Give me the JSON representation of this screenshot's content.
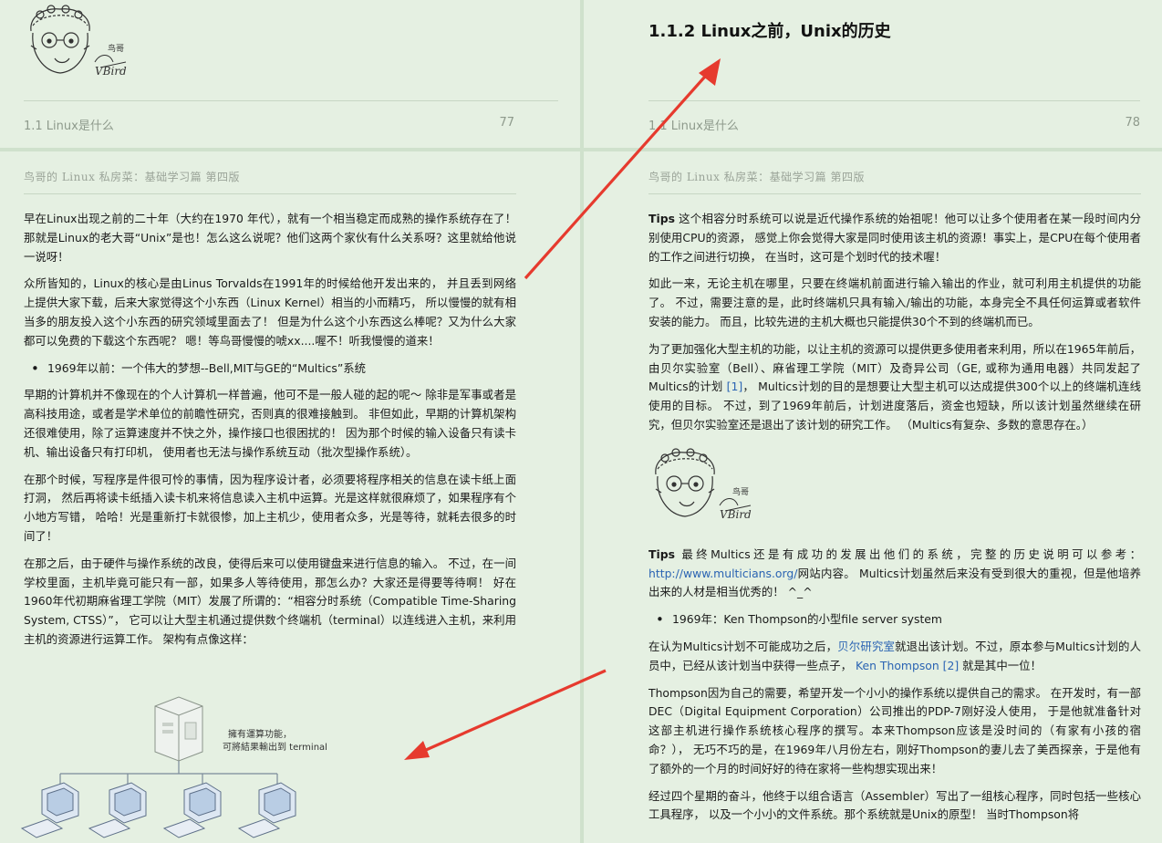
{
  "top": {
    "left": {
      "section": "1.1 Linux是什么",
      "page": "77",
      "logo_text": "鸟哥"
    },
    "right": {
      "heading": "1.1.2 Linux之前，Unix的历史",
      "section": "1.1 Linux是什么",
      "page": "78"
    }
  },
  "left_page": {
    "running_header": "鸟哥的 Linux 私房菜：基础学习篇 第四版",
    "p1": "早在Linux出现之前的二十年（大约在1970 年代），就有一个相当稳定而成熟的操作系统存在了！ 那就是Linux的老大哥“Unix”是也！怎么这么说呢？他们这两个家伙有什么关系呀？这里就给他说一说呀！",
    "p2": "众所皆知的，Linux的核心是由Linus Torvalds在1991年的时候给他开发出来的， 并且丢到网络上提供大家下载，后来大家觉得这个小东西（Linux Kernel）相当的小而精巧， 所以慢慢的就有相当多的朋友投入这个小东西的研究领域里面去了！ 但是为什么这个小东西这么棒呢？又为什么大家都可以免费的下载这个东西呢？ 嗯！等鸟哥慢慢的唬xx....喔不！听我慢慢的道来！",
    "bullet1": "1969年以前：一个伟大的梦想--Bell,MIT与GE的“Multics”系统",
    "p3": "早期的计算机并不像现在的个人计算机一样普遍，他可不是一般人碰的起的呢～ 除非是军事或者是高科技用途，或者是学术单位的前瞻性研究，否则真的很难接触到。 非但如此，早期的计算机架构还很难使用，除了运算速度并不快之外，操作接口也很困扰的！ 因为那个时候的输入设备只有读卡机、输出设备只有打印机， 使用者也无法与操作系统互动（批次型操作系统）。",
    "p4": "在那个时候，写程序是件很可怜的事情，因为程序设计者，必须要将程序相关的信息在读卡纸上面打洞， 然后再将读卡纸插入读卡机来将信息读入主机中运算。光是这样就很麻烦了，如果程序有个小地方写错， 哈哈！光是重新打卡就很惨，加上主机少，使用者众多，光是等待，就耗去很多的时间了！",
    "p5": "在那之后，由于硬件与操作系统的改良，使得后来可以使用键盘来进行信息的输入。 不过，在一间学校里面，主机毕竟可能只有一部，如果多人等待使用，那怎么办？大家还是得要等待啊！ 好在1960年代初期麻省理工学院（MIT）发展了所谓的：“相容分时系统（Compatible Time-Sharing System, CTSS）”， 它可以让大型主机通过提供数个终端机（terminal）以连线进入主机，来利用主机的资源进行运算工作。 架构有点像这样：",
    "diagram_label_1": "擁有運算功能，",
    "diagram_label_2": "可將結果輸出到 terminal"
  },
  "right_page": {
    "running_header": "鸟哥的 Linux 私房菜：基础学习篇 第四版",
    "tips1_label": "Tips",
    "tips1_text": " 这个相容分时系统可以说是近代操作系统的始祖呢！他可以让多个使用者在某一段时间内分别使用CPU的资源， 感觉上你会觉得大家是同时使用该主机的资源！事实上，是CPU在每个使用者的工作之间进行切换， 在当时，这可是个划时代的技术喔！",
    "p1": "如此一来，无论主机在哪里，只要在终端机前面进行输入输出的作业，就可利用主机提供的功能了。 不过，需要注意的是，此时终端机只具有输入/输出的功能，本身完全不具任何运算或者软件安装的能力。 而且，比较先进的主机大概也只能提供30个不到的终端机而已。",
    "p2_a": "为了更加强化大型主机的功能，以让主机的资源可以提供更多使用者来利用，所以在1965年前后， 由贝尔实验室（Bell）、麻省理工学院（MIT）及奇异公司（GE, 或称为通用电器）共同发起了Multics的计划 ",
    "p2_link": "[1]",
    "p2_b": "， Multics计划的目的是想要让大型主机可以达成提供300个以上的终端机连线使用的目标。 不过，到了1969年前后，计划进度落后，资金也短缺，所以该计划虽然继续在研究，但贝尔实验室还是退出了该计划的研究工作。 （Multics有复杂、多数的意思存在。）",
    "logo_text": "鸟哥",
    "tips2_label": "Tips",
    "tips2_a": " 最终Multics还是有成功的发展出他们的系统，完整的历史说明可以参考：",
    "tips2_link": "http://www.multicians.org/",
    "tips2_b": "网站内容。 Multics计划虽然后来没有受到很大的重视，但是他培养出来的人材是相当优秀的！ ^_^",
    "bullet2": "1969年：Ken Thompson的小型file server system",
    "p3_a": "在认为Multics计划不可能成功之后，",
    "p3_link1": "贝尔研究室",
    "p3_b": "就退出该计划。不过，原本参与Multics计划的人员中，已经从该计划当中获得一些点子， ",
    "p3_link2": "Ken Thompson [2]",
    "p3_c": " 就是其中一位！",
    "p4": "Thompson因为自己的需要，希望开发一个小小的操作系统以提供自己的需求。 在开发时，有一部DEC（Digital Equipment Corporation）公司推出的PDP-7刚好没人使用， 于是他就准备针对这部主机进行操作系统核心程序的撰写。本来Thompson应该是没时间的（有家有小孩的宿命？）， 无巧不巧的是，在1969年八月份左右，刚好Thompson的妻儿去了美西探亲，于是他有了额外的一个月的时间好好的待在家将一些构想实现出来！",
    "p5": "经过四个星期的奋斗，他终于以组合语言（Assembler）写出了一组核心程序，同时包括一些核心工具程序， 以及一个小小的文件系统。那个系统就是Unix的原型！ 当时Thompson将"
  },
  "colors": {
    "page_bg": "#e5f0e2",
    "gutter": "#cfe1cc",
    "link": "#2b64b3",
    "arrow": "#e63a2e"
  }
}
